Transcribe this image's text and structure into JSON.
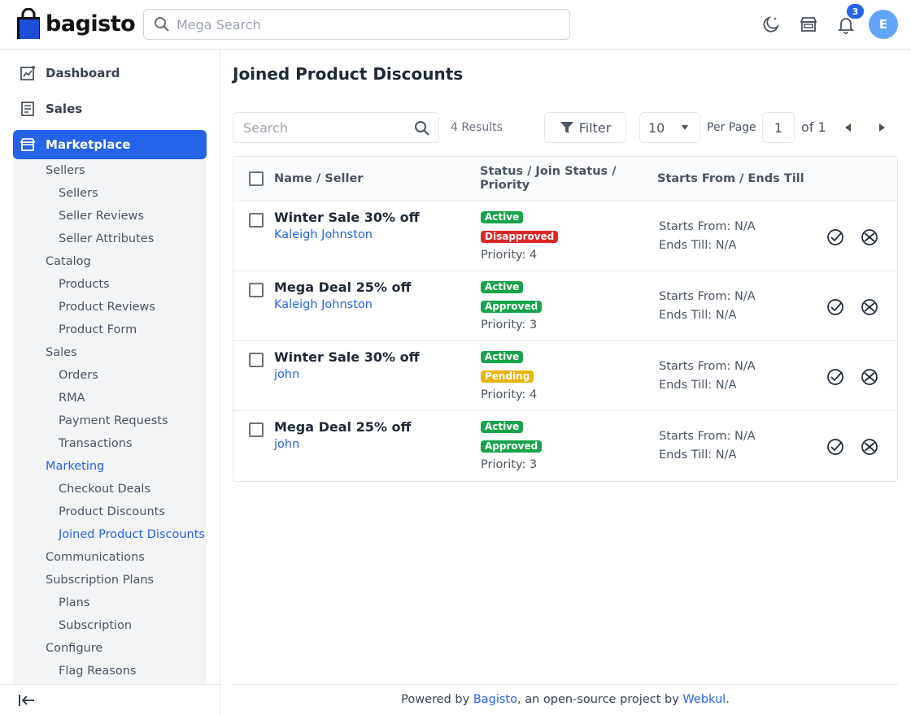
{
  "header": {
    "logo_text": "bagisto",
    "search_placeholder": "Mega Search",
    "notification_count": "3",
    "avatar_initial": "E"
  },
  "sidebar": {
    "top_items": [
      {
        "label": "Dashboard",
        "icon": "dashboard-icon"
      },
      {
        "label": "Sales",
        "icon": "sales-icon"
      },
      {
        "label": "Marketplace",
        "icon": "store-icon",
        "active": true
      }
    ],
    "sub_items": [
      {
        "label": "Sellers",
        "level": 1
      },
      {
        "label": "Sellers",
        "level": 2
      },
      {
        "label": "Seller Reviews",
        "level": 2
      },
      {
        "label": "Seller Attributes",
        "level": 2
      },
      {
        "label": "Catalog",
        "level": 1
      },
      {
        "label": "Products",
        "level": 2
      },
      {
        "label": "Product Reviews",
        "level": 2
      },
      {
        "label": "Product Form",
        "level": 2
      },
      {
        "label": "Sales",
        "level": 1
      },
      {
        "label": "Orders",
        "level": 2
      },
      {
        "label": "RMA",
        "level": 2
      },
      {
        "label": "Payment Requests",
        "level": 2
      },
      {
        "label": "Transactions",
        "level": 2
      },
      {
        "label": "Marketing",
        "level": 1,
        "active": true
      },
      {
        "label": "Checkout Deals",
        "level": 2
      },
      {
        "label": "Product Discounts",
        "level": 2
      },
      {
        "label": "Joined Product Discounts",
        "level": 2,
        "active": true
      },
      {
        "label": "Communications",
        "level": 1
      },
      {
        "label": "Subscription Plans",
        "level": 1
      },
      {
        "label": "Plans",
        "level": 2
      },
      {
        "label": "Subscription",
        "level": 2
      },
      {
        "label": "Configure",
        "level": 1
      },
      {
        "label": "Flag Reasons",
        "level": 2
      }
    ]
  },
  "main": {
    "title": "Joined Product Discounts",
    "search_placeholder": "Search",
    "results": "4 Results",
    "filter_label": "Filter",
    "per_page_value": "10",
    "per_page_label": "Per Page",
    "page_value": "1",
    "of_label": "of 1"
  },
  "table": {
    "headers": {
      "name": "Name / Seller",
      "status_line1": "Status / Join Status /",
      "status_line2": "Priority",
      "dates": "Starts From / Ends Till"
    },
    "rows": [
      {
        "name": "Winter Sale 30% off",
        "seller": "Kaleigh Johnston",
        "status": "Active",
        "join_status": "Disapproved",
        "join_color": "red",
        "priority": "Priority: 4",
        "starts": "Starts From: N/A",
        "ends": "Ends Till: N/A"
      },
      {
        "name": "Mega Deal 25% off",
        "seller": "Kaleigh Johnston",
        "status": "Active",
        "join_status": "Approved",
        "join_color": "green",
        "priority": "Priority: 3",
        "starts": "Starts From: N/A",
        "ends": "Ends Till: N/A"
      },
      {
        "name": "Winter Sale 30% off",
        "seller": "john",
        "status": "Active",
        "join_status": "Pending",
        "join_color": "yellow",
        "priority": "Priority: 4",
        "starts": "Starts From: N/A",
        "ends": "Ends Till: N/A"
      },
      {
        "name": "Mega Deal 25% off",
        "seller": "john",
        "status": "Active",
        "join_status": "Approved",
        "join_color": "green",
        "priority": "Priority: 3",
        "starts": "Starts From: N/A",
        "ends": "Ends Till: N/A"
      }
    ]
  },
  "footer": {
    "prefix": "Powered by ",
    "link1": "Bagisto",
    "middle": ", an open-source project by ",
    "link2": "Webkul",
    "suffix": "."
  },
  "colors": {
    "accent": "#2563eb",
    "success": "#16a34a",
    "danger": "#dc2626",
    "warning": "#eab308"
  }
}
